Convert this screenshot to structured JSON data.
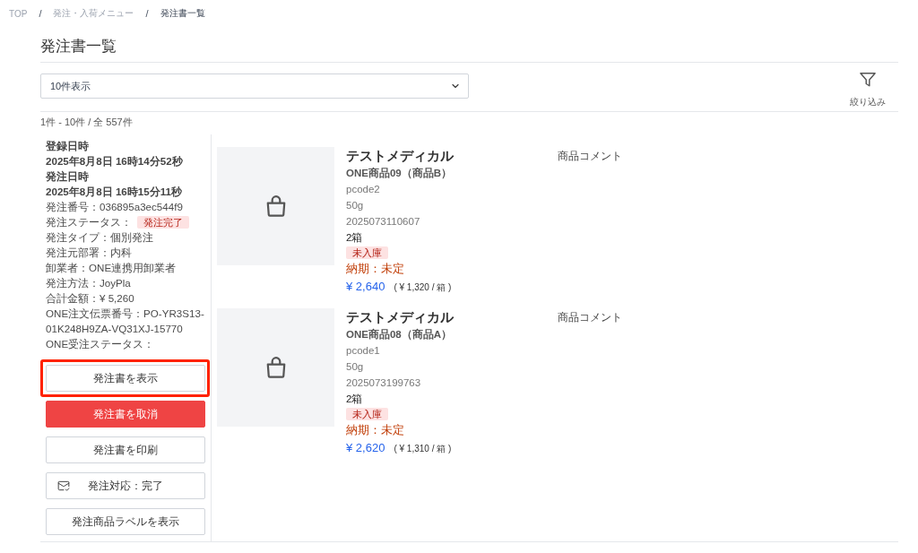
{
  "breadcrumb": [
    {
      "kind": "link",
      "text": "TOP"
    },
    {
      "kind": "separator",
      "text": "/"
    },
    {
      "kind": "link",
      "text": "発注・入荷メニュー"
    },
    {
      "kind": "separator",
      "text": "/"
    },
    {
      "kind": "current",
      "text": "発注書一覧"
    }
  ],
  "page_title": "発注書一覧",
  "toolbar": {
    "per_page_select": {
      "value": "10件表示"
    },
    "filter_button": {
      "label": "絞り込み"
    }
  },
  "result_count": "1件 - 10件 / 全 557件",
  "orders": [
    {
      "details": [
        {
          "kind": "heading",
          "text": "登録日時"
        },
        {
          "kind": "heading",
          "text": "2025年8月8日 16時14分52秒"
        },
        {
          "kind": "heading",
          "text": "発注日時"
        },
        {
          "kind": "heading",
          "text": "2025年8月8日 16時15分11秒"
        },
        {
          "kind": "text",
          "text": "発注番号：036895a3ec544f9"
        },
        {
          "kind": "status",
          "text": "発注ステータス：",
          "badge": "発注完了"
        },
        {
          "kind": "text",
          "text": "発注タイプ：個別発注"
        },
        {
          "kind": "text",
          "text": "発注元部署：内科"
        },
        {
          "kind": "text",
          "text": "卸業者：ONE連携用卸業者"
        },
        {
          "kind": "text",
          "text": "発注方法：JoyPla"
        },
        {
          "kind": "text",
          "text": "合計金額：¥ 5,260"
        },
        {
          "kind": "text",
          "text": "ONE注文伝票番号：PO-YR3S13-01K248H9ZA-VQ31XJ-15770"
        },
        {
          "kind": "text",
          "text": "ONE受注ステータス："
        }
      ],
      "actions": [
        {
          "kind": "outline",
          "label": "発注書を表示",
          "highlighted": true
        },
        {
          "kind": "danger",
          "label": "発注書を取消",
          "highlighted": false
        },
        {
          "kind": "outline",
          "label": "発注書を印刷",
          "highlighted": false
        },
        {
          "kind": "mail",
          "label": "発注対応：完了",
          "highlighted": false
        },
        {
          "kind": "outline",
          "label": "発注商品ラベルを表示",
          "highlighted": false
        }
      ],
      "items": [
        {
          "supplier": "テストメディカル",
          "product_name": "ONE商品09（商品B）",
          "code": "pcode2",
          "size": "50g",
          "number": "2025073110607",
          "quantity": "2箱",
          "receipt_status": "未入庫",
          "delivery": "納期：未定",
          "price": "¥ 2,640",
          "unit_price": "( ¥ 1,320 / 箱 )",
          "comment_label": "商品コメント"
        },
        {
          "supplier": "テストメディカル",
          "product_name": "ONE商品08（商品A）",
          "code": "pcode1",
          "size": "50g",
          "number": "2025073199763",
          "quantity": "2箱",
          "receipt_status": "未入庫",
          "delivery": "納期：未定",
          "price": "¥ 2,620",
          "unit_price": "( ¥ 1,310 / 箱 )",
          "comment_label": "商品コメント"
        }
      ]
    }
  ]
}
